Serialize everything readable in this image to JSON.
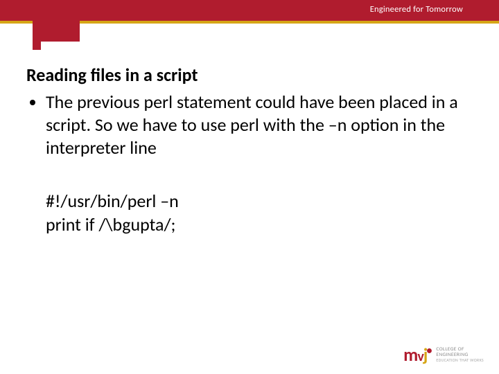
{
  "header": {
    "tagline": "Engineered for Tomorrow"
  },
  "content": {
    "heading": "Reading files in a script",
    "bullet1": "The previous perl statement could have been placed in a script. So we have to use perl with the –n option in the interpreter line",
    "code_line1": "#!/usr/bin/perl –n",
    "code_line2": "print if /\\bgupta/;"
  },
  "logo": {
    "m": "m",
    "v": "v",
    "j": "j",
    "dot": "•",
    "line1": "COLLEGE OF",
    "line2": "ENGINEERING",
    "line3": "EDUCATION THAT WORKS"
  }
}
